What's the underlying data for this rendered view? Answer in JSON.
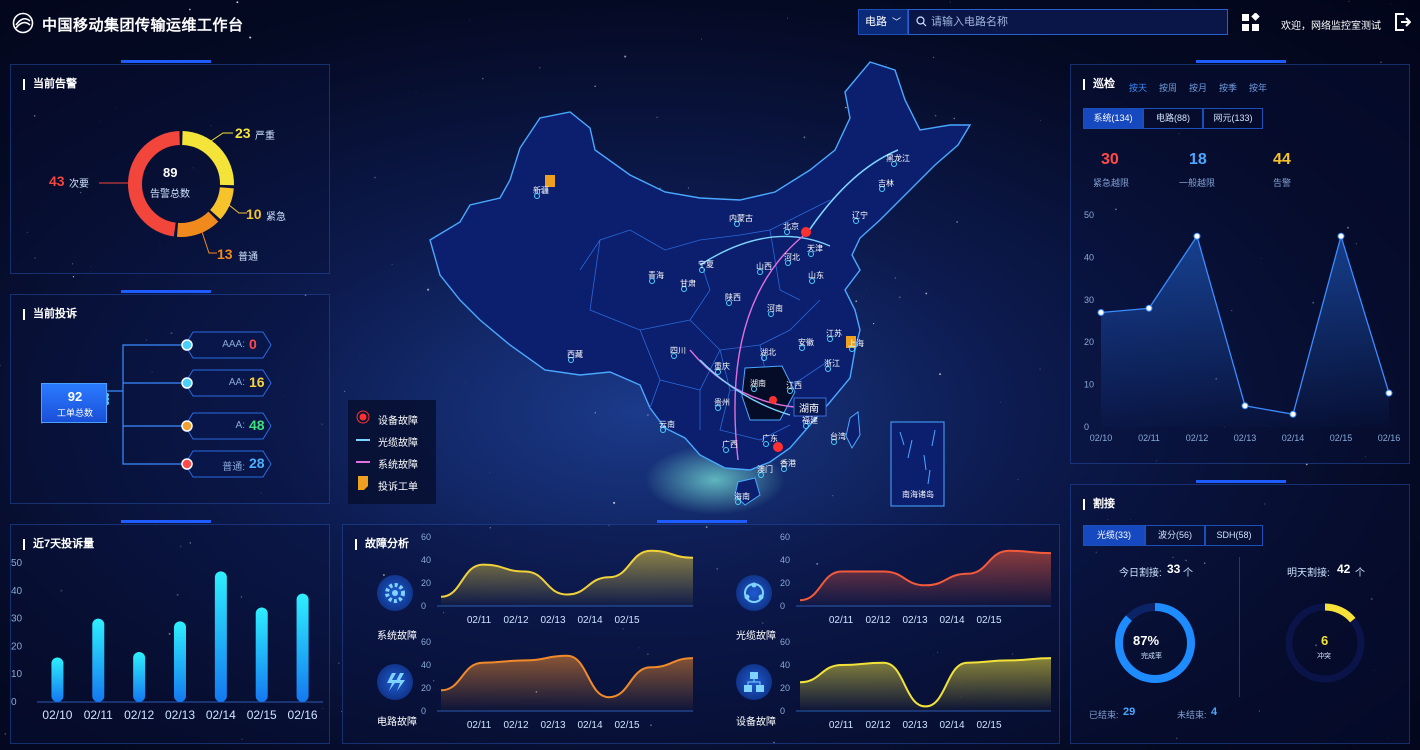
{
  "header": {
    "title": "中国移动集团传输运维工作台",
    "search_type": "电路",
    "search_placeholder": "请输入电路名称",
    "welcome": "欢迎，网络监控室测试"
  },
  "alarm_panel": {
    "title": "当前告警",
    "total": "89",
    "total_label": "告警总数",
    "items": [
      {
        "value": "23",
        "label": "严重",
        "color": "#f4e43a"
      },
      {
        "value": "10",
        "label": "紧急",
        "color": "#f7c32d"
      },
      {
        "value": "13",
        "label": "普通",
        "color": "#f08a1c"
      },
      {
        "value": "43",
        "label": "次要",
        "color": "#f2453b"
      }
    ]
  },
  "complaint_panel": {
    "title": "当前投诉",
    "total": "92",
    "total_label": "工单总数",
    "levels": [
      {
        "label": "AAA:",
        "value": "0",
        "color": "#ff4a4a",
        "dot": "#4ad0ff"
      },
      {
        "label": "AA:",
        "value": "16",
        "color": "#f7d23a",
        "dot": "#4ad0ff"
      },
      {
        "label": "A:",
        "value": "48",
        "color": "#3ee07a",
        "dot": "#f0a030"
      },
      {
        "label": "普通:",
        "value": "28",
        "color": "#4ab0ff",
        "dot": "#ff4a4a"
      }
    ]
  },
  "week_complaints": {
    "title": "近7天投诉量"
  },
  "fault_analysis": {
    "title": "故障分析",
    "system_fault": "系统故障",
    "cable_fault": "光缆故障",
    "circuit_fault": "电路故障",
    "device_fault": "设备故障"
  },
  "map_legend": [
    {
      "label": "设备故障",
      "icon": "device-fault-icon",
      "color": "#ff3030"
    },
    {
      "label": "光缆故障",
      "icon": "cable-line-icon",
      "color": "#7fd4ff"
    },
    {
      "label": "系统故障",
      "icon": "system-line-icon",
      "color": "#e070e0"
    },
    {
      "label": "投诉工单",
      "icon": "ticket-icon",
      "color": "#f0a020"
    }
  ],
  "map": {
    "provinces": [
      "新疆",
      "内蒙古",
      "黑龙江",
      "吉林",
      "辽宁",
      "北京",
      "天津",
      "河北",
      "山西",
      "宁夏",
      "甘肃",
      "青海",
      "陕西",
      "河南",
      "山东",
      "江苏",
      "安徽",
      "上海",
      "浙江",
      "湖北",
      "四川",
      "重庆",
      "西藏",
      "湖南",
      "江西",
      "贵州",
      "云南",
      "广西",
      "广东",
      "福建",
      "台湾",
      "香港",
      "澳门",
      "海南"
    ],
    "inset_label": "南海诸岛",
    "highlight_label": "湖南"
  },
  "inspection_panel": {
    "title": "巡检",
    "tabs": [
      "按天",
      "按周",
      "按月",
      "按季",
      "按年"
    ],
    "segments": [
      "系统(134)",
      "电路(88)",
      "网元(133)"
    ],
    "stats": [
      {
        "value": "30",
        "label": "紧急越限",
        "color": "#ff4a4a"
      },
      {
        "value": "18",
        "label": "一般越限",
        "color": "#4aa8ff"
      },
      {
        "value": "44",
        "label": "告警",
        "color": "#f7c32d"
      }
    ]
  },
  "cutover_panel": {
    "title": "割接",
    "segments": [
      "光缆(33)",
      "波分(56)",
      "SDH(58)"
    ],
    "today_label": "今日割接:",
    "today_value": "33",
    "unit": "个",
    "tomorrow_label": "明天割接:",
    "tomorrow_value": "42",
    "ring1_value": "87%",
    "ring1_label": "完成率",
    "ring1_fraction": 0.87,
    "ring2_value": "6",
    "ring2_label": "冲突",
    "ring2_fraction": 0.14,
    "finished_label": "已结束:",
    "finished_value": "29",
    "unfinished_label": "未结束:",
    "unfinished_value": "4"
  },
  "chart_data": [
    {
      "type": "pie",
      "title": "当前告警",
      "categories": [
        "严重",
        "紧急",
        "普通",
        "次要"
      ],
      "values": [
        23,
        10,
        13,
        43
      ]
    },
    {
      "type": "bar",
      "title": "近7天投诉量",
      "categories": [
        "02/10",
        "02/11",
        "02/12",
        "02/13",
        "02/14",
        "02/15",
        "02/16"
      ],
      "values": [
        16,
        30,
        18,
        29,
        47,
        34,
        39
      ],
      "ylim": [
        0,
        50
      ],
      "yticks": [
        0,
        10,
        20,
        30,
        40,
        50
      ]
    },
    {
      "type": "area",
      "title": "系统故障",
      "categories": [
        "02/11",
        "02/12",
        "02/13",
        "02/14",
        "02/15"
      ],
      "x": [
        0,
        1,
        2,
        3,
        4,
        5,
        6
      ],
      "values": [
        8,
        36,
        30,
        10,
        25,
        48,
        42
      ],
      "color": "#f2d23a",
      "ylim": [
        0,
        60
      ],
      "yticks": [
        0,
        20,
        40,
        60
      ]
    },
    {
      "type": "area",
      "title": "光缆故障",
      "categories": [
        "02/11",
        "02/12",
        "02/13",
        "02/14",
        "02/15"
      ],
      "values": [
        5,
        30,
        30,
        18,
        28,
        48,
        46
      ],
      "color": "#f25a3a",
      "ylim": [
        0,
        60
      ],
      "yticks": [
        0,
        20,
        40,
        60
      ]
    },
    {
      "type": "area",
      "title": "电路故障",
      "categories": [
        "02/11",
        "02/12",
        "02/13",
        "02/14",
        "02/15"
      ],
      "values": [
        18,
        42,
        44,
        48,
        12,
        38,
        46
      ],
      "color": "#f08a2a",
      "ylim": [
        0,
        60
      ],
      "yticks": [
        0,
        20,
        40,
        60
      ]
    },
    {
      "type": "area",
      "title": "设备故障",
      "categories": [
        "02/11",
        "02/12",
        "02/13",
        "02/14",
        "02/15"
      ],
      "values": [
        25,
        40,
        42,
        4,
        42,
        44,
        46
      ],
      "color": "#f2e23a",
      "ylim": [
        0,
        60
      ],
      "yticks": [
        0,
        20,
        40,
        60
      ]
    },
    {
      "type": "line",
      "title": "巡检",
      "categories": [
        "02/10",
        "02/11",
        "02/12",
        "02/13",
        "02/14",
        "02/15",
        "02/16"
      ],
      "values": [
        27,
        28,
        45,
        5,
        3,
        45,
        8
      ],
      "ylim": [
        0,
        50
      ],
      "yticks": [
        0,
        10,
        20,
        30,
        40,
        50
      ]
    }
  ]
}
